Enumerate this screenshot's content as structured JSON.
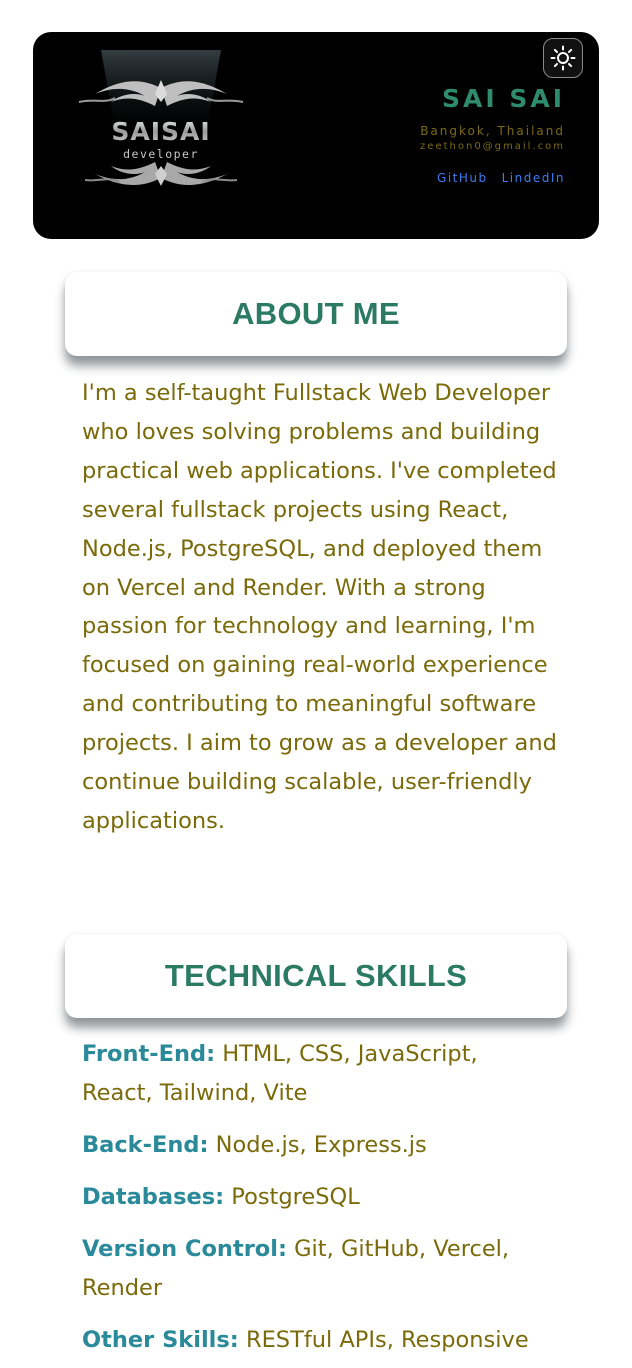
{
  "header": {
    "logo_text": "SAISAI",
    "logo_subtext": "developer",
    "name": "SAI SAI",
    "location": "Bangkok, Thailand",
    "email": "zeethon0@gmail.com",
    "links": [
      "GitHub",
      "LindedIn"
    ],
    "theme_toggle_icon": "sun-icon"
  },
  "about": {
    "title": "ABOUT ME",
    "body": "I'm a self-taught Fullstack Web Developer who loves solving problems and building practical web applications. I've completed several fullstack projects using React, Node.js, PostgreSQL, and deployed them on Vercel and Render. With a strong passion for technology and learning, I'm focused on gaining real-world experience and contributing to meaningful software projects. I aim to grow as a developer and continue building scalable, user-friendly applications."
  },
  "skills": {
    "title": "TECHNICAL SKILLS",
    "items": [
      {
        "label": "Front-End:",
        "value": "HTML, CSS, JavaScript, React, Tailwind, Vite"
      },
      {
        "label": "Back-End:",
        "value": "Node.js, Express.js"
      },
      {
        "label": "Databases:",
        "value": "PostgreSQL"
      },
      {
        "label": "Version Control:",
        "value": "Git, GitHub, Vercel, Render"
      },
      {
        "label": "Other Skills:",
        "value": "RESTful APIs, Responsive"
      }
    ]
  },
  "colors": {
    "accent_green": "#2b7a62",
    "body_text": "#7a6a0a",
    "skill_label": "#2a8a9a",
    "link_blue": "#3e7cf0",
    "hero_bg": "#000000"
  }
}
